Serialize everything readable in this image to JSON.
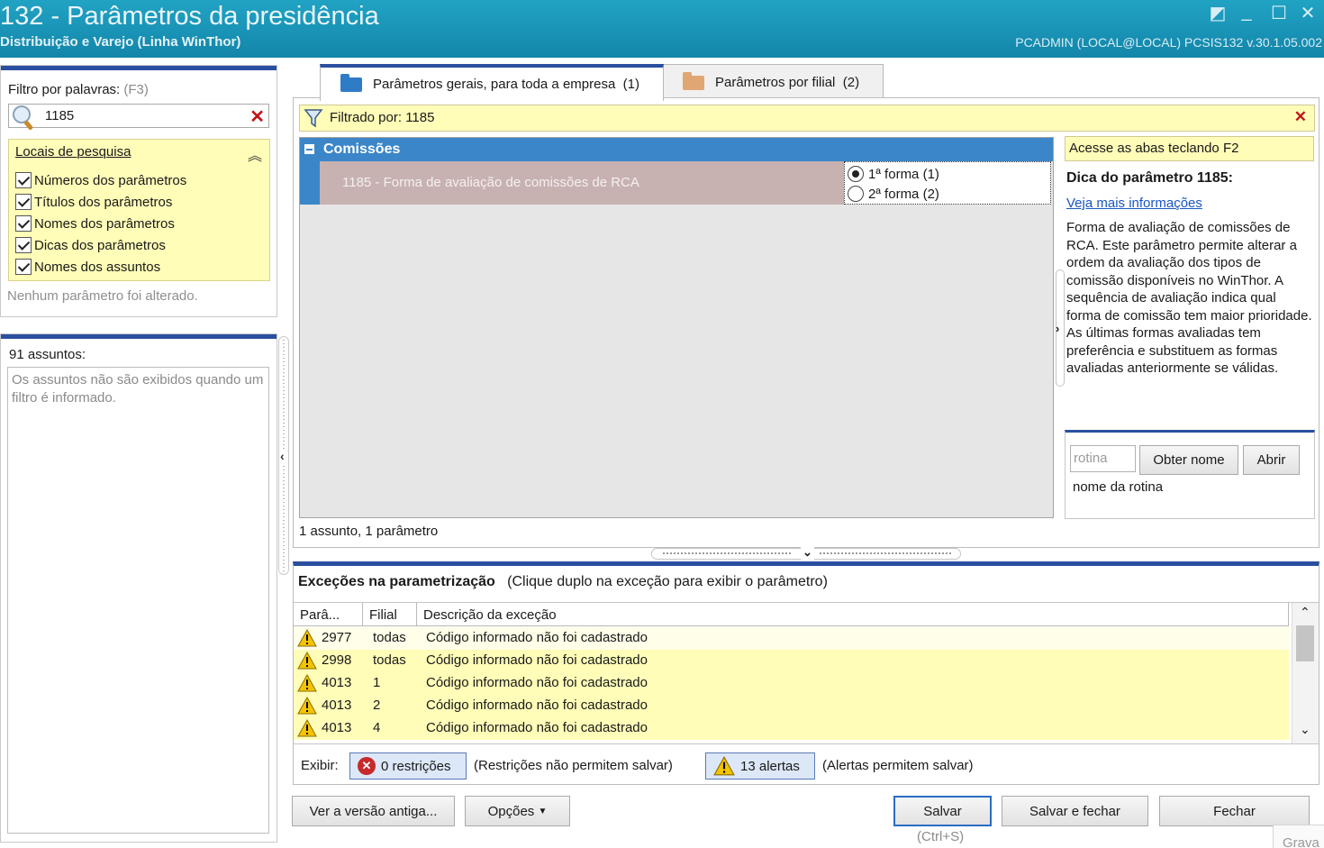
{
  "window": {
    "title": "132 - Parâmetros da presidência",
    "subtitle": "Distribuição e Varejo (Linha WinThor)",
    "user_info": "PCADMIN (LOCAL@LOCAL)   PCSIS132  v.30.1.05.002"
  },
  "filter": {
    "label": "Filtro por palavras:",
    "shortcut": "(F3)",
    "search_value": "1185",
    "locais_title": "Locais de pesquisa",
    "options": [
      {
        "label": "Números dos parâmetros",
        "checked": true
      },
      {
        "label": "Títulos dos parâmetros",
        "checked": true
      },
      {
        "label": "Nomes dos parâmetros",
        "checked": true
      },
      {
        "label": "Dicas dos parâmetros",
        "checked": true
      },
      {
        "label": "Nomes dos assuntos",
        "checked": true
      }
    ],
    "status": "Nenhum parâmetro foi alterado."
  },
  "assuntos": {
    "count_label": "91 assuntos:",
    "message": "Os assuntos não são exibidos quando um filtro é informado."
  },
  "tabs": [
    {
      "label": "Parâmetros gerais, para toda a empresa",
      "count": "(1)",
      "active": true
    },
    {
      "label": "Parâmetros por filial",
      "count": "(2)",
      "active": false
    }
  ],
  "filtered_bar": {
    "text": "Filtrado por: 1185"
  },
  "grid": {
    "group_title": "Comissões",
    "param_name": "1185 - Forma de avaliação de comissões de RCA",
    "options": [
      {
        "label": "1ª forma (1)",
        "selected": true
      },
      {
        "label": "2ª forma (2)",
        "selected": false
      }
    ],
    "summary": "1 assunto, 1 parâmetro"
  },
  "help": {
    "access_hint": "Acesse as abas teclando F2",
    "title": "Dica do parâmetro 1185:",
    "link": "Veja mais informações",
    "text": "Forma de avaliação de comissões de RCA. Este parâmetro permite alterar a ordem da avaliação dos tipos de comissão disponíveis no WinThor. A sequência de avaliação indica qual forma de comissão tem maior prioridade. As últimas formas avaliadas tem preferência e substituem as formas avaliadas anteriormente se válidas.",
    "rotina_placeholder": "rotina",
    "obter_nome_label": "Obter nome",
    "abrir_label": "Abrir",
    "rotina_name": "nome da rotina"
  },
  "exceptions": {
    "title": "Exceções na parametrização",
    "hint": "(Clique duplo na exceção para exibir o parâmetro)",
    "columns": [
      "Parâ...",
      "Filial",
      "Descrição da exceção"
    ],
    "rows": [
      {
        "param": "2977",
        "filial": "todas",
        "descricao": "Código informado não foi cadastrado"
      },
      {
        "param": "2998",
        "filial": "todas",
        "descricao": "Código informado não foi cadastrado"
      },
      {
        "param": "4013",
        "filial": "1",
        "descricao": "Código informado não foi cadastrado"
      },
      {
        "param": "4013",
        "filial": "2",
        "descricao": "Código informado não foi cadastrado"
      },
      {
        "param": "4013",
        "filial": "4",
        "descricao": "Código informado não foi cadastrado"
      }
    ],
    "exibir_label": "Exibir:",
    "restricoes_label": "0 restrições",
    "restricoes_note": "(Restrições não permitem salvar)",
    "alertas_label": "13 alertas",
    "alertas_note": "(Alertas permitem salvar)"
  },
  "buttons": {
    "old_version": "Ver a versão antiga...",
    "options": "Opções",
    "save": "Salvar",
    "save_shortcut": "(Ctrl+S)",
    "save_close": "Salvar e fechar",
    "close": "Fechar"
  },
  "status_corner": "Grava",
  "colors": {
    "titlebar": "#1993b6",
    "accent_blue": "#2b4fa0",
    "group_header": "#3b86c8",
    "highlight_yellow": "#fffdb8",
    "error_red": "#c0151b"
  }
}
